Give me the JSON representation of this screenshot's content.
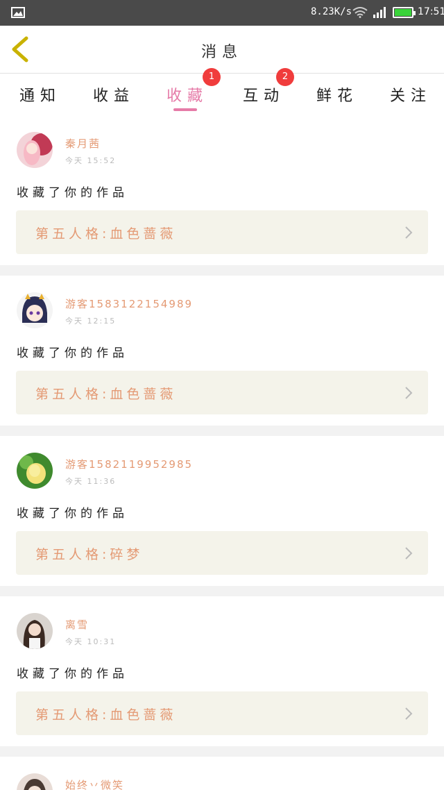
{
  "status_bar": {
    "speed": "8.23K/s",
    "time": "17:51",
    "battery_color": "#3ad33a"
  },
  "header": {
    "title": "消息"
  },
  "tabs": [
    {
      "label": "通知",
      "badge": ""
    },
    {
      "label": "收益",
      "badge": ""
    },
    {
      "label": "收藏",
      "badge": "1",
      "active": true
    },
    {
      "label": "互动",
      "badge": "2"
    },
    {
      "label": "鲜花",
      "badge": ""
    },
    {
      "label": "关注",
      "badge": ""
    }
  ],
  "colors": {
    "accent": "#e67ba8",
    "name": "#e49a74",
    "badge": "#f03c3c",
    "work_bg": "#f4f3ea"
  },
  "items": [
    {
      "name": "秦月茜",
      "time": "今天 15:52",
      "action": "收藏了你的作品",
      "work": "第五人格:血色蔷薇",
      "avatar": "avatar-pink"
    },
    {
      "name": "游客1583122154989",
      "time": "今天 12:15",
      "action": "收藏了你的作品",
      "work": "第五人格:血色蔷薇",
      "avatar": "avatar-anime"
    },
    {
      "name": "游客1582119952985",
      "time": "今天 11:36",
      "action": "收藏了你的作品",
      "work": "第五人格:碎梦",
      "avatar": "avatar-flower"
    },
    {
      "name": "离雪",
      "time": "今天 10:31",
      "action": "收藏了你的作品",
      "work": "第五人格:血色蔷薇",
      "avatar": "avatar-girl"
    },
    {
      "name": "始终丷微笑",
      "time": "",
      "action": "",
      "work": "",
      "avatar": "avatar-partial"
    }
  ]
}
